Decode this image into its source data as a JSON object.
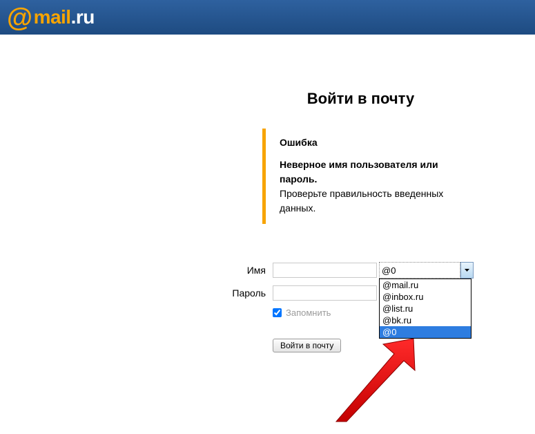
{
  "logo": {
    "at": "@",
    "mail": "mail",
    "dot": ".",
    "ru": "ru"
  },
  "title": "Войти в почту",
  "error": {
    "title": "Ошибка",
    "strong": "Неверное имя пользователя или пароль.",
    "text": "Проверьте правильность введенных данных."
  },
  "form": {
    "name_label": "Имя",
    "name_value": "",
    "password_label": "Пароль",
    "password_value": "",
    "remember_label": "Запомнить",
    "remember_checked": true,
    "submit_label": "Войти в почту"
  },
  "domain": {
    "selected": "@0",
    "options": [
      "@mail.ru",
      "@inbox.ru",
      "@list.ru",
      "@bk.ru",
      "@0"
    ]
  },
  "colors": {
    "accent": "#f7a400",
    "header": "#1e4b81",
    "select": "#2e7de0"
  }
}
